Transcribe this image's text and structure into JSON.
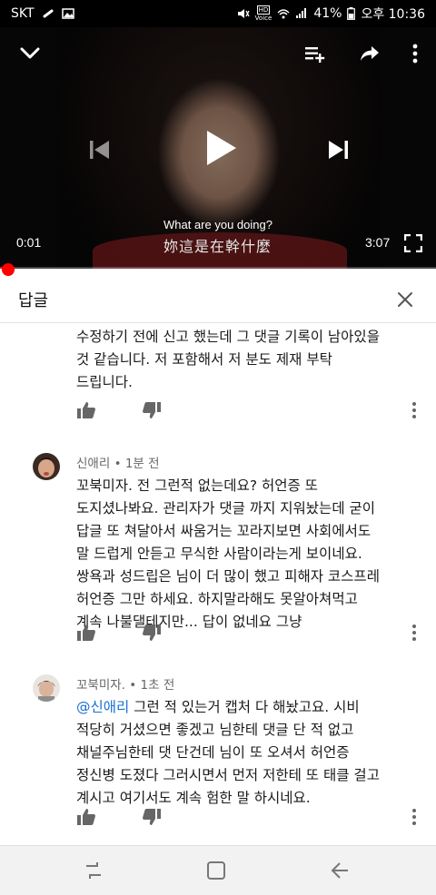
{
  "status_bar": {
    "carrier": "SKT",
    "battery": "41%",
    "time": "오후 10:36",
    "voice_label": "Voice",
    "hd_label": "HD"
  },
  "player": {
    "subtitle_en": "What are you doing?",
    "subtitle_zh": "妳這是在幹什麼",
    "current_time": "0:01",
    "duration": "3:07",
    "progress": 0.005
  },
  "replies": {
    "title": "답글"
  },
  "comments": [
    {
      "lines": [
        "수정하기 전에 신고 했는데 그 댓글 기록이 남아있을",
        "것 같습니다. 저 포함해서 저 분도 제재 부탁",
        "드립니다."
      ]
    },
    {
      "author": "신애리",
      "time": "1분 전",
      "lines": [
        "꼬북미자. 전 그런적 없는데요? 허언증 또",
        "도지셨나봐요. 관리자가 댓글 까지 지워놨는데 굳이",
        "답글 또 쳐달아서 싸움거는 꼬라지보면 사회에서도",
        "말 드럽게 안듣고 무식한 사람이라는게 보이네요.",
        "쌍욕과 성드립은 님이 더 많이 했고 피해자 코스프레",
        "허언증 그만 하세요. 하지말라해도 못알아쳐먹고",
        "계속 나불댈테지만... 답이 없네요 그냥"
      ]
    },
    {
      "author": "꼬북미자.",
      "time": "1초 전",
      "mention": "@신애리",
      "first_line_rest": " 그런 적 있는거 캡처 다 해놨고요. 시비",
      "lines": [
        "적당히 거셨으면 좋겠고 님한테 댓글 단 적 없고",
        "채널주님한테 댓 단건데 님이 또 오셔서 허언증",
        "정신병 도졌다 그러시면서 먼저 저한테 또 태클 걸고",
        "계시고 여기서도 계속 험한 말 하시네요."
      ]
    }
  ]
}
